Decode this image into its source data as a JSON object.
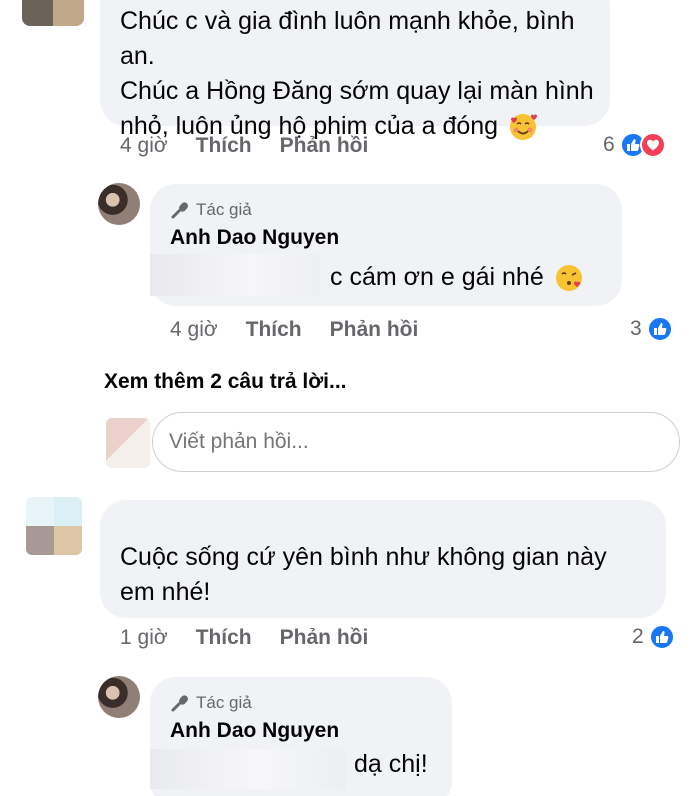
{
  "comment1": {
    "text_lines": [
      "Chúc c và gia đình luôn mạnh khỏe, bình an.",
      "Chúc a Hồng Đăng sớm quay lại màn hình",
      "nhỏ, luôn ủng hộ phim của a đóng"
    ],
    "emoji_icon": "smiling-face-with-hearts-icon",
    "time": "4 giờ",
    "like_label": "Thích",
    "reply_label": "Phản hồi",
    "reaction_count": "6"
  },
  "reply1": {
    "author_badge": "Tác giả",
    "author_name": "Anh Dao Nguyen",
    "text": "c cám ơn e gái nhé",
    "emoji_icon": "face-blowing-kiss-icon",
    "time": "4 giờ",
    "like_label": "Thích",
    "reply_label": "Phản hồi",
    "reaction_count": "3"
  },
  "more_replies": "Xem thêm 2 câu trả lời...",
  "reply_input": {
    "placeholder": "Viết phản hồi..."
  },
  "comment2": {
    "text_lines": [
      "Cuộc sống cứ yên bình như không gian này",
      "em nhé!"
    ],
    "time": "1 giờ",
    "like_label": "Thích",
    "reply_label": "Phản hồi",
    "reaction_count": "2"
  },
  "reply2": {
    "author_badge": "Tác giả",
    "author_name": "Anh Dao Nguyen",
    "text": "dạ chị!"
  },
  "colors": {
    "bubble": "#f0f2f5",
    "meta_text": "#65676b",
    "like_blue": "#1877f2",
    "love_red": "#f33e58"
  }
}
